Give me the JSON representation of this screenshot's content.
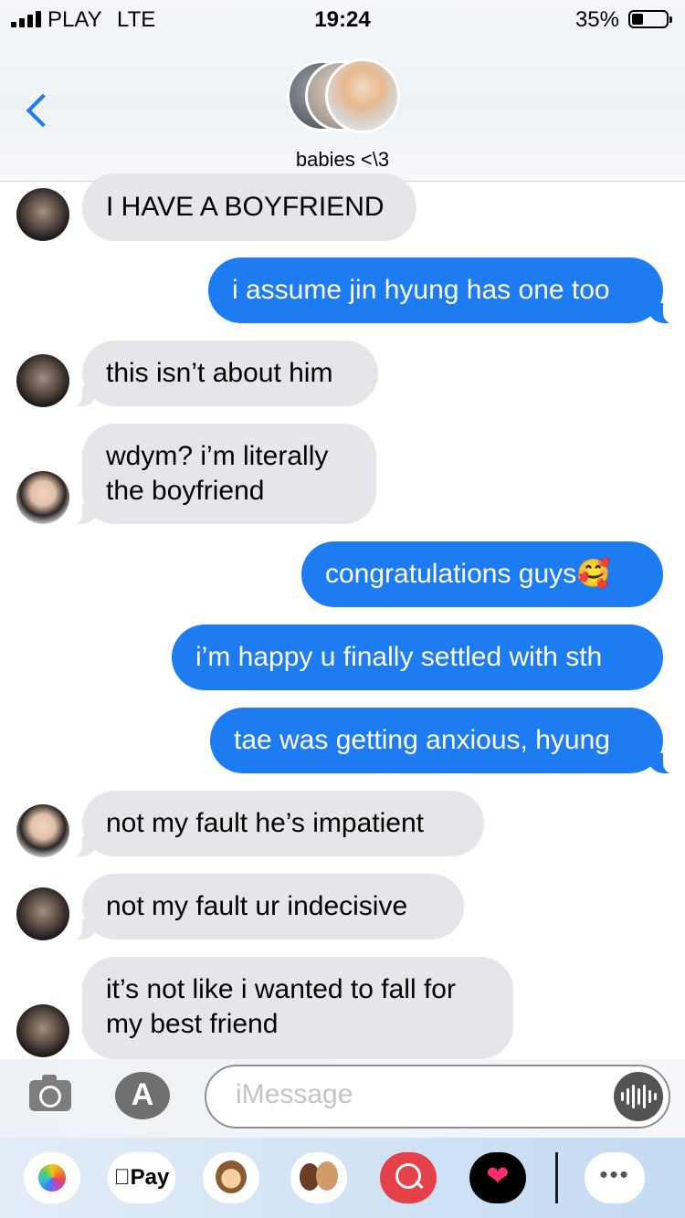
{
  "status_bar": {
    "carrier": "PLAY",
    "network": "LTE",
    "time": "19:24",
    "battery": "35%",
    "battery_level": 0.35
  },
  "header": {
    "back_icon": "chevron-left-icon",
    "group_name": "babies <\\3"
  },
  "messages": [
    {
      "dir": "in",
      "sender": "tae",
      "lines": [
        "I HAVE A BOYFRIEND"
      ]
    },
    {
      "dir": "out",
      "lines": [
        "i assume jin hyung has one too"
      ]
    },
    {
      "dir": "in",
      "sender": "tae",
      "lines": [
        "this isn’t about him"
      ]
    },
    {
      "dir": "in",
      "sender": "jin",
      "lines": [
        "wdym? i’m literally",
        "the boyfriend"
      ]
    },
    {
      "dir": "out",
      "lines": [
        "congratulations guys🥰"
      ]
    },
    {
      "dir": "out",
      "lines": [
        "i’m happy u finally settled with sth"
      ]
    },
    {
      "dir": "out",
      "lines": [
        "tae was getting anxious, hyung"
      ]
    },
    {
      "dir": "in",
      "sender": "jin",
      "lines": [
        "not my fault he’s impatient"
      ]
    },
    {
      "dir": "in",
      "sender": "tae",
      "lines": [
        "not my fault ur indecisive"
      ]
    },
    {
      "dir": "in",
      "sender": "tae",
      "lines": [
        "it’s not like i wanted to fall for",
        "my best friend"
      ]
    }
  ],
  "input_bar": {
    "placeholder": "iMessage",
    "camera_icon": "camera-icon",
    "apps_icon": "app-store-icon",
    "audio_icon": "audio-waveform-icon",
    "apps_glyph": "A"
  },
  "app_drawer": {
    "apps": [
      "photos-icon",
      "apple-pay",
      "animoji-monkey-icon",
      "memoji-stickers-icon",
      "web-images-search-icon",
      "digital-touch-heart-icon",
      "more-icon"
    ],
    "apple_pay_label": "Pay"
  },
  "colors": {
    "outgoing_bubble": "#1e7cf3",
    "incoming_bubble": "#e5e5ea",
    "accent": "#1a7cf5"
  }
}
